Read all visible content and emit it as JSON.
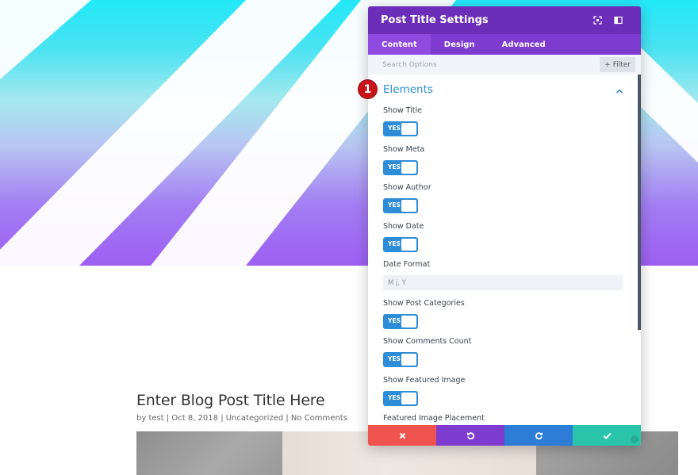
{
  "modal": {
    "title": "Post Title Settings",
    "tabs": [
      {
        "label": "Content"
      },
      {
        "label": "Design"
      },
      {
        "label": "Advanced"
      }
    ],
    "search": {
      "placeholder": "Search Options",
      "filter_label": "Filter"
    },
    "section": {
      "title": "Elements",
      "badge_number": "1"
    },
    "fields": {
      "show_title": {
        "label": "Show Title",
        "value": "YES"
      },
      "show_meta": {
        "label": "Show Meta",
        "value": "YES"
      },
      "show_author": {
        "label": "Show Author",
        "value": "YES"
      },
      "show_date": {
        "label": "Show Date",
        "value": "YES"
      },
      "date_format": {
        "label": "Date Format",
        "value": "M j, Y"
      },
      "show_post_categories": {
        "label": "Show Post Categories",
        "value": "YES"
      },
      "show_comments_count": {
        "label": "Show Comments Count",
        "value": "YES"
      },
      "show_featured_image": {
        "label": "Show Featured Image",
        "value": "YES"
      },
      "featured_image_placement": {
        "label": "Featured Image Placement"
      }
    },
    "footer": {
      "discard_icon": "close-icon",
      "undo_icon": "undo-icon",
      "redo_icon": "redo-icon",
      "save_icon": "check-icon"
    },
    "colors": {
      "header": "#6c2eb9",
      "tabs": "#7d3bd0",
      "accent": "#2e8dd8",
      "discard": "#ef5350",
      "save": "#29c4a9"
    }
  },
  "post": {
    "title": "Enter Blog Post Title Here",
    "meta": "by test | Oct 8, 2018 | Uncategorized | No Comments"
  }
}
